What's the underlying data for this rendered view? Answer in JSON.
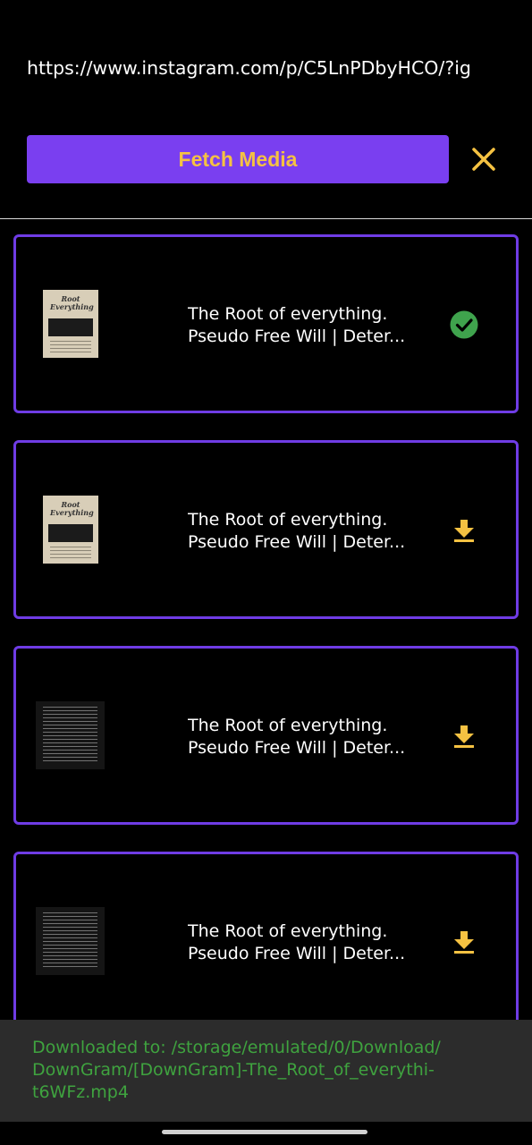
{
  "header": {
    "url_value": "https://www.instagram.com/p/C5LnPDbyHCO/?ig"
  },
  "actions": {
    "fetch_label": "Fetch Media",
    "close_icon": "close-icon",
    "accent_color": "#7a3ff0",
    "button_text_color": "#f5c242"
  },
  "items": [
    {
      "title_line1": "The Root of everything.",
      "title_line2": "Pseudo Free Will | Deter...",
      "thumb_text": "Root Everything",
      "status": "downloaded",
      "status_icon": "check-circle-icon"
    },
    {
      "title_line1": "The Root of everything.",
      "title_line2": "Pseudo Free Will | Deter...",
      "thumb_text": "Root Everything",
      "status": "pending",
      "status_icon": "download-icon"
    },
    {
      "title_line1": "The Root of everything.",
      "title_line2": "Pseudo Free Will | Deter...",
      "thumb_text": "",
      "status": "pending",
      "status_icon": "download-icon"
    },
    {
      "title_line1": "The Root of everything.",
      "title_line2": "Pseudo Free Will | Deter...",
      "thumb_text": "",
      "status": "pending",
      "status_icon": "download-icon"
    }
  ],
  "toast": {
    "line1": "Downloaded to: /storage/emulated/0/Download/",
    "line2": "DownGram/[DownGram]-The_Root_of_everythi-",
    "line3": "t6WFz.mp4",
    "text_color": "#3fa33f"
  }
}
